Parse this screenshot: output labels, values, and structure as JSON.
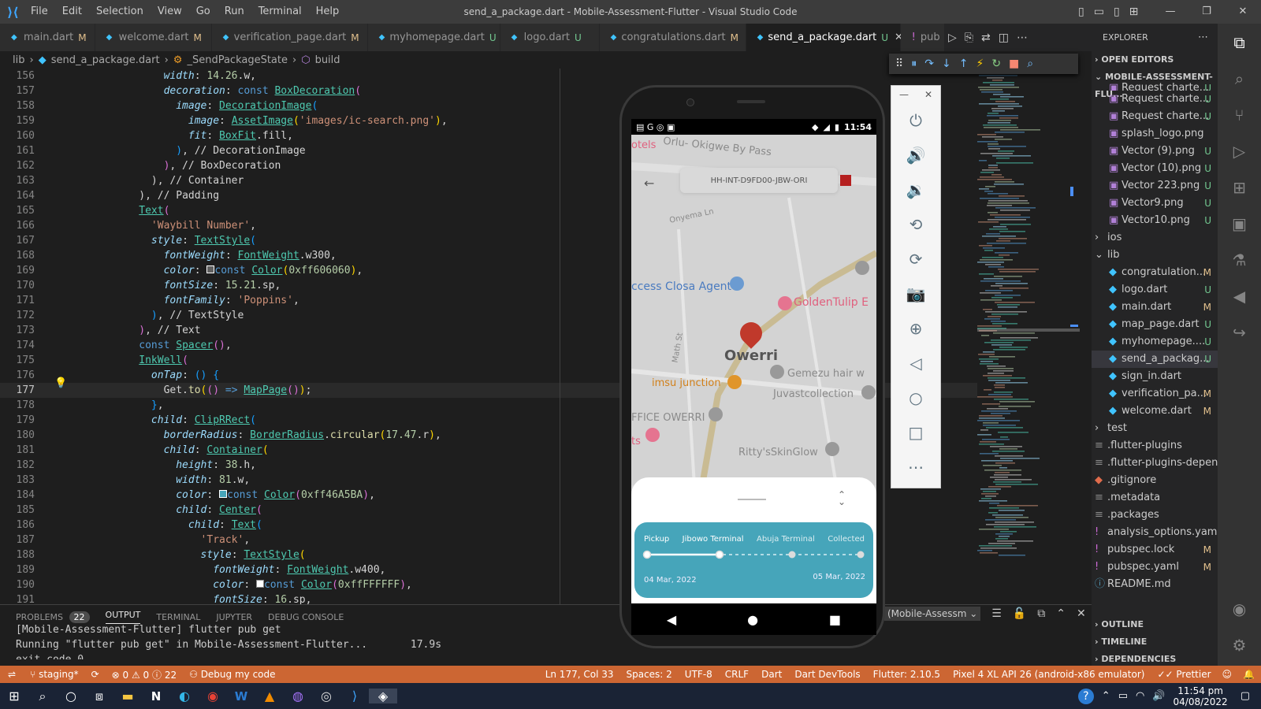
{
  "titlebar": {
    "menu": [
      "File",
      "Edit",
      "Selection",
      "View",
      "Go",
      "Run",
      "Terminal",
      "Help"
    ],
    "title": "send_a_package.dart - Mobile-Assessment-Flutter - Visual Studio Code"
  },
  "tabs": [
    {
      "label": "main.dart",
      "status": "M"
    },
    {
      "label": "welcome.dart",
      "status": "M"
    },
    {
      "label": "verification_page.dart",
      "status": "M"
    },
    {
      "label": "myhomepage.dart",
      "status": "U"
    },
    {
      "label": "logo.dart",
      "status": "U"
    },
    {
      "label": "congratulations.dart",
      "status": "M"
    },
    {
      "label": "send_a_package.dart",
      "status": "U"
    },
    {
      "label": "pub",
      "status": "!"
    }
  ],
  "breadcrumb": [
    "lib",
    "send_a_package.dart",
    "_SendPackageState",
    "build"
  ],
  "editor": {
    "current_line": 177,
    "lines": [
      {
        "n": 156,
        "html": "              <span class='prm'>width</span><span class='pl'>: </span><span class='num'>14.26</span><span class='pl'>.w,</span>"
      },
      {
        "n": 157,
        "html": "              <span class='prm'>decoration</span><span class='pl'>: </span><span class='kw'>const</span> <span class='cls'>BoxDecoration</span><span class='pu'>(</span>"
      },
      {
        "n": 158,
        "html": "                <span class='prm'>image</span><span class='pl'>: </span><span class='cls'>DecorationImage</span><span class='bl'>(</span>"
      },
      {
        "n": 159,
        "html": "                  <span class='prm'>image</span><span class='pl'>: </span><span class='cls'>AssetImage</span><span class='yb'>(</span><span class='str'>'images/ic-search.png'</span><span class='yb'>)</span><span class='pl'>,</span>"
      },
      {
        "n": 160,
        "html": "                  <span class='prm'>fit</span><span class='pl'>: </span><span class='cls'>BoxFit</span><span class='pl'>.fill,</span>"
      },
      {
        "n": 161,
        "html": "                <span class='bl'>)</span><span class='pl'>, // DecorationImage</span>"
      },
      {
        "n": 162,
        "html": "              <span class='pu'>)</span><span class='pl'>, // BoxDecoration</span>"
      },
      {
        "n": 163,
        "html": "            <span class='pl'>), // Container</span>"
      },
      {
        "n": 164,
        "html": "          <span class='pl'>), // Padding</span>"
      },
      {
        "n": 165,
        "html": "          <span class='cls'>Text</span><span class='pu'>(</span>"
      },
      {
        "n": 166,
        "html": "            <span class='str'>'Waybill Number'</span><span class='pl'>,</span>"
      },
      {
        "n": 167,
        "html": "            <span class='prm'>style</span><span class='pl'>: </span><span class='cls'>TextStyle</span><span class='bl'>(</span>"
      },
      {
        "n": 168,
        "html": "              <span class='prm'>fontWeight</span><span class='pl'>: </span><span class='cls'>FontWeight</span><span class='pl'>.w300,</span>"
      },
      {
        "n": 169,
        "html": "              <span class='prm'>color</span><span class='pl'>: </span><span style='display:inline-block;width:10px;height:10px;background:#606060;border:1px solid #fff'></span><span class='kw'>const</span> <span class='cls'>Color</span><span class='yb'>(</span><span class='num'>0xff606060</span><span class='yb'>)</span><span class='pl'>,</span>"
      },
      {
        "n": 170,
        "html": "              <span class='prm'>fontSize</span><span class='pl'>: </span><span class='num'>15.21</span><span class='pl'>.sp,</span>"
      },
      {
        "n": 171,
        "html": "              <span class='prm'>fontFamily</span><span class='pl'>: </span><span class='str'>'Poppins'</span><span class='pl'>,</span>"
      },
      {
        "n": 172,
        "html": "            <span class='bl'>)</span><span class='pl'>, // TextStyle</span>"
      },
      {
        "n": 173,
        "html": "          <span class='pu'>)</span><span class='pl'>, // Text</span>"
      },
      {
        "n": 174,
        "html": "          <span class='kw'>const</span> <span class='cls'>Spacer</span><span class='pu'>()</span><span class='pl'>,</span>"
      },
      {
        "n": 175,
        "html": "          <span class='cls'>InkWell</span><span class='pu'>(</span>"
      },
      {
        "n": 176,
        "html": "            <span class='prm'>onTap</span><span class='pl'>: </span><span class='bl'>()</span><span class='pl'> </span><span class='bl'>{</span>"
      },
      {
        "n": 177,
        "html": "              <span class='pl'>Get.</span><span class='fn'>to</span><span class='yb'>(</span><span class='pu'>()</span><span class='pl'> </span><span class='kw'>=&gt;</span><span class='pl'> </span><span class='cls'>MapPage</span><span class='pu'>()</span><span class='yb'>)</span><span class='pl'>;</span>"
      },
      {
        "n": 178,
        "html": "            <span class='bl'>}</span><span class='pl'>,</span>"
      },
      {
        "n": 179,
        "html": "            <span class='prm'>child</span><span class='pl'>: </span><span class='cls'>ClipRRect</span><span class='bl'>(</span>"
      },
      {
        "n": 180,
        "html": "              <span class='prm'>borderRadius</span><span class='pl'>: </span><span class='cls'>BorderRadius</span><span class='pl'>.</span><span class='fn'>circular</span><span class='yb'>(</span><span class='num'>17.47</span><span class='pl'>.r</span><span class='yb'>)</span><span class='pl'>,</span>"
      },
      {
        "n": 181,
        "html": "              <span class='prm'>child</span><span class='pl'>: </span><span class='cls'>Container</span><span class='yb'>(</span>"
      },
      {
        "n": 182,
        "html": "                <span class='prm'>height</span><span class='pl'>: </span><span class='num'>38</span><span class='pl'>.h,</span>"
      },
      {
        "n": 183,
        "html": "                <span class='prm'>width</span><span class='pl'>: </span><span class='num'>81</span><span class='pl'>.w,</span>"
      },
      {
        "n": 184,
        "html": "                <span class='prm'>color</span><span class='pl'>: </span><span style='display:inline-block;width:10px;height:10px;background:#46A5BA;border:1px solid #fff'></span><span class='kw'>const</span> <span class='cls'>Color</span><span class='pu'>(</span><span class='num'>0xff46A5BA</span><span class='pu'>)</span><span class='pl'>,</span>"
      },
      {
        "n": 185,
        "html": "                <span class='prm'>child</span><span class='pl'>: </span><span class='cls'>Center</span><span class='pu'>(</span>"
      },
      {
        "n": 186,
        "html": "                  <span class='prm'>child</span><span class='pl'>: </span><span class='cls'>Text</span><span class='bl'>(</span>"
      },
      {
        "n": 187,
        "html": "                    <span class='str'>'Track'</span><span class='pl'>,</span>"
      },
      {
        "n": 188,
        "html": "                    <span class='prm'>style</span><span class='pl'>: </span><span class='cls'>TextStyle</span><span class='yb'>(</span>"
      },
      {
        "n": 189,
        "html": "                      <span class='prm'>fontWeight</span><span class='pl'>: </span><span class='cls'>FontWeight</span><span class='pl'>.w400,</span>"
      },
      {
        "n": 190,
        "html": "                      <span class='prm'>color</span><span class='pl'>: </span><span style='display:inline-block;width:10px;height:10px;background:#FFFFFF;border:1px solid #888'></span><span class='kw'>const</span> <span class='cls'>Color</span><span class='pu'>(</span><span class='num'>0xffFFFFFF</span><span class='pu'>)</span><span class='pl'>,</span>"
      },
      {
        "n": 191,
        "html": "                      <span class='prm'>fontSize</span><span class='pl'>: </span><span class='num'>16</span><span class='pl'>.sp,</span>"
      }
    ]
  },
  "explorer": {
    "header": "EXPLORER",
    "open_editors": "OPEN EDITORS",
    "project": "MOBILE-ASSESSMENT-FLU...",
    "items": [
      {
        "label": "Request charte...",
        "status": "U",
        "indent": 22,
        "icon": "img"
      },
      {
        "label": "Request charte...",
        "status": "U",
        "indent": 22,
        "icon": "img"
      },
      {
        "label": "Request charte...",
        "status": "U",
        "indent": 22,
        "icon": "img"
      },
      {
        "label": "splash_logo.png",
        "status": "",
        "indent": 22,
        "icon": "img"
      },
      {
        "label": "Vector (9).png",
        "status": "U",
        "indent": 22,
        "icon": "img"
      },
      {
        "label": "Vector (10).png",
        "status": "U",
        "indent": 22,
        "icon": "img"
      },
      {
        "label": "Vector 223.png",
        "status": "U",
        "indent": 22,
        "icon": "img"
      },
      {
        "label": "Vector9.png",
        "status": "U",
        "indent": 22,
        "icon": "img"
      },
      {
        "label": "Vector10.png",
        "status": "U",
        "indent": 22,
        "icon": "img"
      },
      {
        "label": "ios",
        "status": "",
        "indent": 4,
        "icon": "folder"
      },
      {
        "label": "lib",
        "status": "",
        "indent": 4,
        "icon": "folder-open"
      },
      {
        "label": "congratulation...",
        "status": "M",
        "indent": 22,
        "icon": "dart"
      },
      {
        "label": "logo.dart",
        "status": "U",
        "indent": 22,
        "icon": "dart"
      },
      {
        "label": "main.dart",
        "status": "M",
        "indent": 22,
        "icon": "dart"
      },
      {
        "label": "map_page.dart",
        "status": "U",
        "indent": 22,
        "icon": "dart"
      },
      {
        "label": "myhomepage....",
        "status": "U",
        "indent": 22,
        "icon": "dart"
      },
      {
        "label": "send_a_packag...",
        "status": "U",
        "indent": 22,
        "icon": "dart",
        "selected": true
      },
      {
        "label": "sign_in.dart",
        "status": "",
        "indent": 22,
        "icon": "dart"
      },
      {
        "label": "verification_pa...",
        "status": "M",
        "indent": 22,
        "icon": "dart"
      },
      {
        "label": "welcome.dart",
        "status": "M",
        "indent": 22,
        "icon": "dart"
      },
      {
        "label": "test",
        "status": "",
        "indent": 4,
        "icon": "folder"
      },
      {
        "label": ".flutter-plugins",
        "status": "",
        "indent": 4,
        "icon": "file"
      },
      {
        "label": ".flutter-plugins-depen...",
        "status": "",
        "indent": 4,
        "icon": "file"
      },
      {
        "label": ".gitignore",
        "status": "",
        "indent": 4,
        "icon": "git"
      },
      {
        "label": ".metadata",
        "status": "",
        "indent": 4,
        "icon": "file"
      },
      {
        "label": ".packages",
        "status": "",
        "indent": 4,
        "icon": "file"
      },
      {
        "label": "analysis_options.yaml",
        "status": "",
        "indent": 4,
        "icon": "yaml"
      },
      {
        "label": "pubspec.lock",
        "status": "M",
        "indent": 4,
        "icon": "yaml"
      },
      {
        "label": "pubspec.yaml",
        "status": "M",
        "indent": 4,
        "icon": "yaml"
      },
      {
        "label": "README.md",
        "status": "",
        "indent": 4,
        "icon": "info"
      }
    ],
    "outline": "OUTLINE",
    "timeline": "TIMELINE",
    "dependencies": "DEPENDENCIES"
  },
  "panel": {
    "tabs": [
      "PROBLEMS",
      "OUTPUT",
      "TERMINAL",
      "JUPYTER",
      "DEBUG CONSOLE"
    ],
    "problems_count": "22",
    "channel": "(Mobile-Assessm",
    "lines": [
      "[Mobile-Assessment-Flutter] flutter pub get",
      "Running \"flutter pub get\" in Mobile-Assessment-Flutter...       17.9s",
      "exit code 0"
    ]
  },
  "statusbar": {
    "branch": "staging*",
    "errors": "0",
    "warnings": "0",
    "infos": "22",
    "debug": "Debug my code",
    "position": "Ln 177, Col 33",
    "spaces": "Spaces: 2",
    "encoding": "UTF-8",
    "eol": "CRLF",
    "lang": "Dart",
    "devtools": "Dart DevTools",
    "flutter": "Flutter: 2.10.5",
    "device": "Pixel 4 XL API 26 (android-x86 emulator)",
    "prettier": "Prettier"
  },
  "phone": {
    "time": "11:54",
    "waybill": "HH-INT-D9FD00-JBW-ORI",
    "map_labels": {
      "hotels": "otels",
      "orlu": "Orlu- Okigwe By Pass",
      "onyema": "Onyema Ln",
      "closa": "ccess Closa Agent",
      "goldentulip": "GoldenTulip E",
      "owerri": "Owerri",
      "imsu": "imsu junction",
      "gemezu": "Gemezu hair w",
      "juvast": "Juvastcollection",
      "office": "FFICE OWERRI",
      "ts": "ts",
      "ritty": "Ritty'sSkinGlow",
      "math": "Math St"
    },
    "tracker": {
      "steps": [
        "Pickup",
        "Jibowo Terminal",
        "Abuja Terminal",
        "Collected"
      ],
      "start_date": "04 Mar, 2022",
      "end_date": "05 Mar, 2022",
      "progress": 0.33
    }
  },
  "taskbar": {
    "time": "11:54 pm",
    "date": "04/08/2022"
  },
  "colors": {
    "statusbar": "#cc6633",
    "accent_teal": "#46A5BA",
    "marker_red": "#d32f2f"
  }
}
